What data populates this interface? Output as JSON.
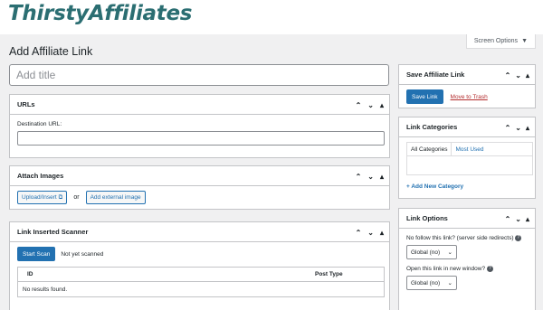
{
  "brand": {
    "name": "ThirstyAffiliates"
  },
  "header": {
    "screen_options": "Screen Options",
    "screen_options_icon": "caret-down-icon"
  },
  "page": {
    "title": "Add Affiliate Link",
    "title_placeholder": "Add title"
  },
  "urls_box": {
    "title": "URLs",
    "destination_label": "Destination URL:",
    "destination_value": ""
  },
  "images_box": {
    "title": "Attach Images",
    "upload_label": "Upload/Insert",
    "upload_icon": "media-icon",
    "or_text": "or",
    "external_label": "Add external image"
  },
  "scanner_box": {
    "title": "Link Inserted Scanner",
    "scan_button": "Start Scan",
    "status": "Not yet scanned",
    "columns": [
      "ID",
      "Post Type"
    ],
    "empty": "No results found."
  },
  "save_box": {
    "title": "Save Affiliate Link",
    "save_label": "Save Link",
    "trash_label": "Move to Trash"
  },
  "categories_box": {
    "title": "Link Categories",
    "tabs": [
      "All Categories",
      "Most Used"
    ],
    "add_label": "+ Add New Category"
  },
  "options_box": {
    "title": "Link Options",
    "nofollow_label": "No follow this link? (server side redirects)",
    "nofollow_value": "Global (no)",
    "newwindow_label": "Open this link in new window?",
    "newwindow_value": "Global (no)"
  },
  "colors": {
    "brand": "#2b6e72",
    "primary": "#2271b1",
    "danger": "#b32d2e",
    "background": "#f0f0f1"
  }
}
